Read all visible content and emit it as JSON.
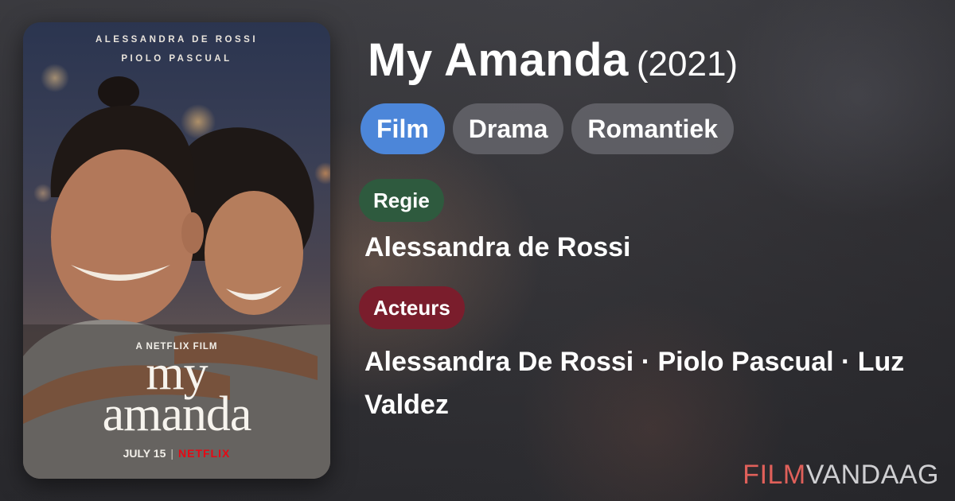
{
  "poster": {
    "credit_line_1": "ALESSANDRA DE ROSSI",
    "credit_line_2": "PIOLO PASCUAL",
    "studio_line": "A NETFLIX FILM",
    "title_line_1": "my",
    "title_line_2": "amanda",
    "release_date": "JULY 15",
    "separator": "|",
    "brand": "NETFLIX"
  },
  "movie": {
    "title": "My Amanda",
    "year": "(2021)"
  },
  "genres": [
    {
      "label": "Film",
      "color": "#4c86d9"
    },
    {
      "label": "Drama",
      "color": "#69696f"
    },
    {
      "label": "Romantiek",
      "color": "#69696f"
    }
  ],
  "director_section": {
    "label": "Regie",
    "color": "#2e5a3e",
    "value": "Alessandra de Rossi"
  },
  "cast_section": {
    "label": "Acteurs",
    "color": "#7a1d2c",
    "value": "Alessandra De Rossi · Piolo Pascual · Luz Valdez"
  },
  "watermark": {
    "part_1": "FILM",
    "part_2": "VANDAAG",
    "color_1": "#e0605a",
    "color_2": "#cfcfd2"
  }
}
